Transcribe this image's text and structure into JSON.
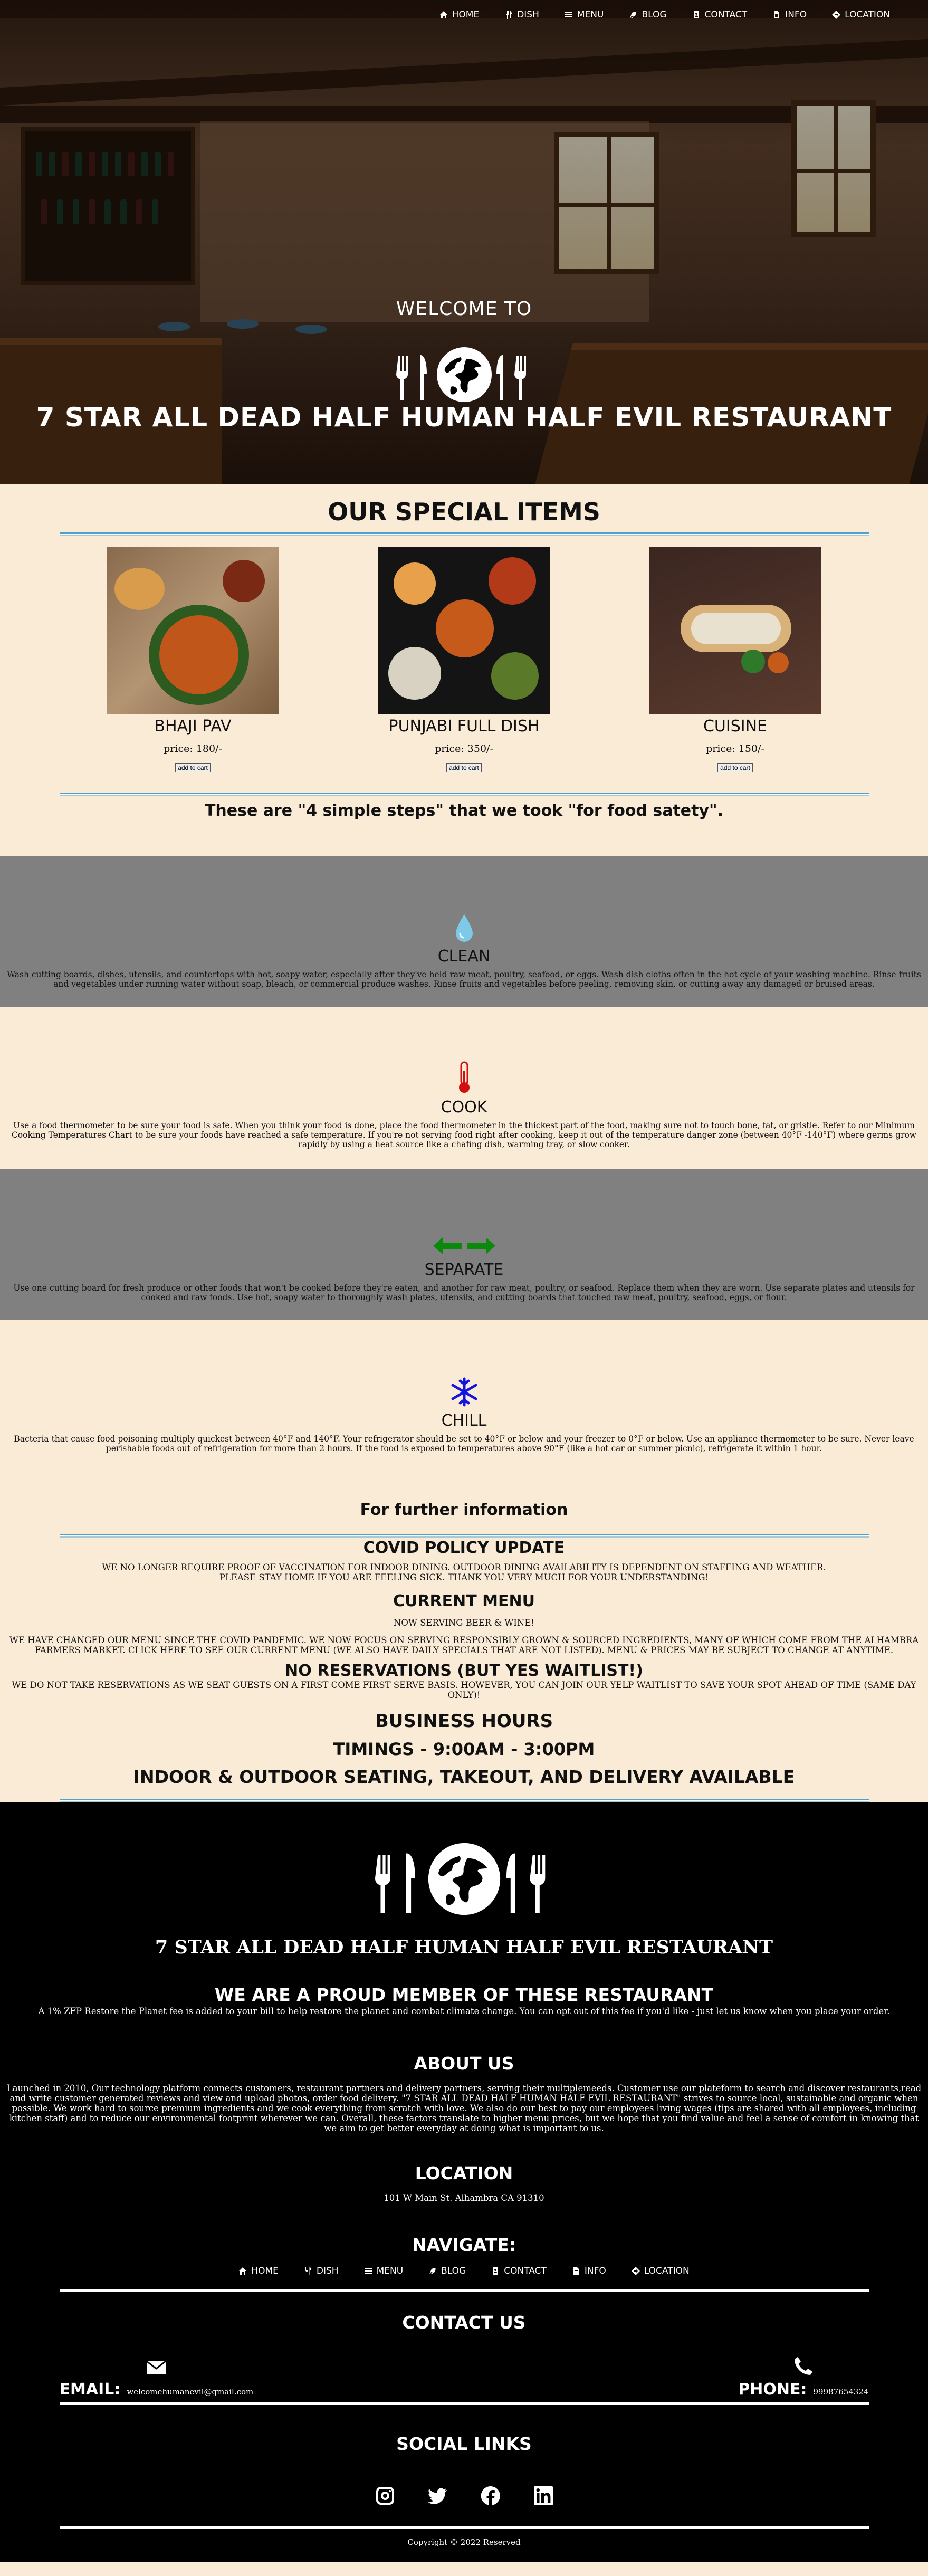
{
  "nav": {
    "items": [
      {
        "label": "HOME",
        "icon": "home-icon"
      },
      {
        "label": "DISH",
        "icon": "utensils-icon"
      },
      {
        "label": "MENU",
        "icon": "list-icon"
      },
      {
        "label": "BLOG",
        "icon": "blog-icon"
      },
      {
        "label": "CONTACT",
        "icon": "contact-card-icon"
      },
      {
        "label": "INFO",
        "icon": "file-icon"
      },
      {
        "label": "LOCATION",
        "icon": "location-diamond-icon"
      }
    ]
  },
  "hero": {
    "welcome": "WELCOME TO",
    "title": "7 STAR ALL DEAD HALF HUMAN HALF EVIL RESTAURANT"
  },
  "specials": {
    "title": "OUR SPECIAL ITEMS",
    "items": [
      {
        "name": "BHAJI PAV",
        "price": "price: 180/-",
        "button": "add to cart"
      },
      {
        "name": "PUNJABI FULL DISH",
        "price": "price: 350/-",
        "button": "add to cart"
      },
      {
        "name": "CUISINE",
        "price": "price: 150/-",
        "button": "add to cart"
      }
    ],
    "steps_title": "These are \"4 simple steps\" that we took \"for food satety\"."
  },
  "steps": [
    {
      "title": "CLEAN",
      "icon": "water-drop-icon",
      "text": "Wash cutting boards, dishes, utensils, and countertops with hot, soapy water, especially after they've held raw meat, poultry, seafood, or eggs. Wash dish cloths often in the hot cycle of your washing machine. Rinse fruits and vegetables under running water without soap, bleach, or commercial produce washes. Rinse fruits and vegetables before peeling, removing skin, or cutting away any damaged or bruised areas."
    },
    {
      "title": "COOK",
      "icon": "thermometer-icon",
      "text": "Use a food thermometer to be sure your food is safe. When you think your food is done, place the food thermometer in the thickest part of the food, making sure not to touch bone, fat, or gristle. Refer to our Minimum Cooking Temperatures Chart to be sure your foods have reached a safe temperature. If you're not serving food right after cooking, keep it out of the temperature danger zone (between 40°F -140°F) where germs grow rapidly by using a heat source like a chafing dish, warming tray, or slow cooker."
    },
    {
      "title": "SEPARATE",
      "icon": "arrows-left-right-icon",
      "text": "Use one cutting board for fresh produce or other foods that won't be cooked before they're eaten, and another for raw meat, poultry, or seafood. Replace them when they are worn. Use separate plates and utensils for cooked and raw foods. Use hot, soapy water to thoroughly wash plates, utensils, and cutting boards that touched raw meat, poultry, seafood, eggs, or flour."
    },
    {
      "title": "CHILL",
      "icon": "snowflake-icon",
      "text": "Bacteria that cause food poisoning multiply quickest between 40°F and 140°F. Your refrigerator should be set to 40°F or below and your freezer to 0°F or below. Use an appliance thermometer to be sure. Never leave perishable foods out of refrigeration for more than 2 hours. If the food is exposed to temperatures above 90°F (like a hot car or summer picnic), refrigerate it within 1 hour."
    }
  ],
  "info": {
    "further": "For further information",
    "covid_title": "COVID POLICY UPDATE",
    "covid_text1": "WE NO LONGER REQUIRE PROOF OF VACCINATION FOR INDOOR DINING. OUTDOOR DINING AVAILABILITY IS DEPENDENT ON STAFFING AND WEATHER.",
    "covid_text2": "PLEASE STAY HOME IF YOU ARE FEELING SICK. THANK YOU VERY MUCH FOR YOUR UNDERSTANDING!",
    "menu_title": "CURRENT MENU",
    "menu_text1": "NOW SERVING BEER & WINE!",
    "menu_text2": "WE HAVE CHANGED OUR MENU SINCE THE COVID PANDEMIC. WE NOW FOCUS ON SERVING RESPONSIBLY GROWN & SOURCED INGREDIENTS, MANY OF WHICH COME FROM THE ALHAMBRA FARMERS MARKET. CLICK HERE TO SEE OUR CURRENT MENU (WE ALSO HAVE DAILY SPECIALS THAT ARE NOT LISTED). MENU & PRICES MAY BE SUBJECT TO CHANGE AT ANYTIME.",
    "res_title": "NO RESERVATIONS (BUT YES WAITLIST!)",
    "res_text": "WE DO NOT TAKE RESERVATIONS AS WE SEAT GUESTS ON A FIRST COME FIRST SERVE BASIS. HOWEVER, YOU CAN JOIN OUR YELP WAITLIST TO SAVE YOUR SPOT AHEAD OF TIME (SAME DAY ONLY)!",
    "hours_title": "BUSINESS HOURS",
    "timings": "TIMINGS - 9:00AM - 3:00PM",
    "seating": "INDOOR & OUTDOOR SEATING, TAKEOUT, AND DELIVERY AVAILABLE"
  },
  "footer": {
    "restaurant": "7 STAR ALL DEAD HALF HUMAN HALF EVIL RESTAURANT",
    "member_title": "WE ARE A PROUD MEMBER OF THESE RESTAURANT",
    "member_text": "A 1% ZFP Restore the Planet fee is added to your bill to help restore the planet and combat climate change. You can opt out of this fee if you'd like - just let us know when you place your order.",
    "about_title": "ABOUT US",
    "about_text": "Launched in 2010, Our technology platform connects customers, restaurant partners and delivery partners, serving their multiplemeeds. Customer use our plateform to search and discover restaurants,read and write customer generated reviews and view and upload photos, order food delivery. \"7 STAR ALL DEAD HALF HUMAN HALF EVIL RESTAURANT\" strives to source local, sustainable and organic when possible. We work hard to source premium ingredients and we cook everything from scratch with love. We also do our best to pay our employees living wages (tips are shared with all employees, including kitchen staff) and to reduce our environmental footprint wherever we can. Overall, these factors translate to higher menu prices, but we hope that you find value and feel a sense of comfort in knowing that we aim to get better everyday at doing what is important to us.",
    "location_title": "LOCATION",
    "address": "101 W Main St. Alhambra CA 91310",
    "navigate_title": "NAVIGATE:",
    "contact_title": "CONTACT US",
    "email_label": "EMAIL:",
    "email": "welcomehumanevil@gmail.com",
    "phone_label": "PHONE:",
    "phone": "99987654324",
    "social_title": "SOCIAL LINKS",
    "socials": [
      "instagram-icon",
      "twitter-icon",
      "facebook-icon",
      "linkedin-icon"
    ],
    "copyright": "Copyright © 2022 Reserved"
  }
}
